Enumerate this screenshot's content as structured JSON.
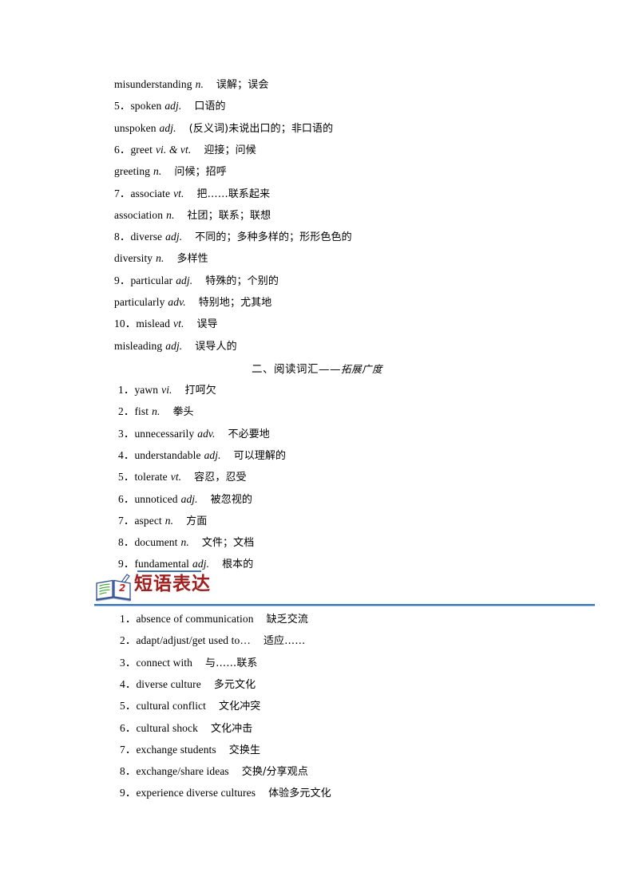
{
  "document": {
    "type": "chinese-english-vocabulary-worksheet",
    "page_background": "#ffffff"
  },
  "colors": {
    "heading_red": "#A02020",
    "rule_blue": "#3E74B8",
    "text_black": "#000000"
  },
  "vocab_continued": {
    "entries": [
      {
        "num": "",
        "word": "misunderstanding",
        "pos": "n.",
        "cn": "误解；误会"
      },
      {
        "num": "5．",
        "word": "spoken",
        "pos": "adj.",
        "cn": "口语的"
      },
      {
        "num": "",
        "word": "unspoken",
        "pos": "adj.",
        "cn": "(反义词)未说出口的；非口语的"
      },
      {
        "num": "6．",
        "word": "greet",
        "pos": "vi. & vt.",
        "cn": "迎接；问候"
      },
      {
        "num": "",
        "word": "greeting",
        "pos": "n.",
        "cn": "问候；招呼"
      },
      {
        "num": "7．",
        "word": "associate",
        "pos": "vt.",
        "cn": "把……联系起来"
      },
      {
        "num": "",
        "word": "association",
        "pos": "n.",
        "cn": "社团；联系；联想"
      },
      {
        "num": "8．",
        "word": "diverse",
        "pos": "adj.",
        "cn": "不同的；多种多样的；形形色色的"
      },
      {
        "num": "",
        "word": "diversity",
        "pos": "n.",
        "cn": "多样性"
      },
      {
        "num": "9．",
        "word": "particular",
        "pos": "adj.",
        "cn": "特殊的；个别的"
      },
      {
        "num": "",
        "word": "particularly",
        "pos": "adv.",
        "cn": "特别地；尤其地"
      },
      {
        "num": "10．",
        "word": "mislead",
        "pos": "vt.",
        "cn": "误导"
      },
      {
        "num": "",
        "word": "misleading",
        "pos": "adj.",
        "cn": "误导人的"
      }
    ]
  },
  "reading_vocab": {
    "heading_main": "二、阅读词汇——",
    "heading_tail": "拓展广度",
    "entries": [
      {
        "num": "1．",
        "word": "yawn",
        "pos": "vi.",
        "cn": "打呵欠"
      },
      {
        "num": "2．",
        "word": "fist",
        "pos": "n.",
        "cn": "拳头"
      },
      {
        "num": "3．",
        "word": "unnecessarily",
        "pos": "adv.",
        "cn": "不必要地"
      },
      {
        "num": "4．",
        "word": "understandable",
        "pos": "adj.",
        "cn": "可以理解的"
      },
      {
        "num": "5．",
        "word": "tolerate",
        "pos": "vt.",
        "cn": "容忍，忍受"
      },
      {
        "num": "6．",
        "word": "unnoticed",
        "pos": "adj.",
        "cn": "被忽视的"
      },
      {
        "num": "7．",
        "word": "aspect",
        "pos": "n.",
        "cn": "方面"
      },
      {
        "num": "8．",
        "word": "document",
        "pos": "n.",
        "cn": "文件；文档"
      },
      {
        "num": "9．",
        "word": "fundamental",
        "pos": "adj.",
        "cn": "根本的"
      }
    ]
  },
  "phrases_section": {
    "banner_title": "短语表达",
    "banner_icon": "open-book-with-pen-icon",
    "entries": [
      {
        "num": "1．",
        "phrase": "absence of communication",
        "cn": "缺乏交流"
      },
      {
        "num": "2．",
        "phrase": "adapt/adjust/get used to…",
        "cn": "适应……"
      },
      {
        "num": "3．",
        "phrase": "connect with",
        "cn": "与……联系"
      },
      {
        "num": "4．",
        "phrase": "diverse culture",
        "cn": "多元文化"
      },
      {
        "num": "5．",
        "phrase": "cultural conflict",
        "cn": "文化冲突"
      },
      {
        "num": "6．",
        "phrase": "cultural shock",
        "cn": "文化冲击"
      },
      {
        "num": "7．",
        "phrase": "exchange students",
        "cn": "交换生"
      },
      {
        "num": "8．",
        "phrase": "exchange/share ideas",
        "cn": "交换/分享观点"
      },
      {
        "num": "9．",
        "phrase": "experience diverse cultures",
        "cn": "体验多元文化"
      }
    ]
  }
}
